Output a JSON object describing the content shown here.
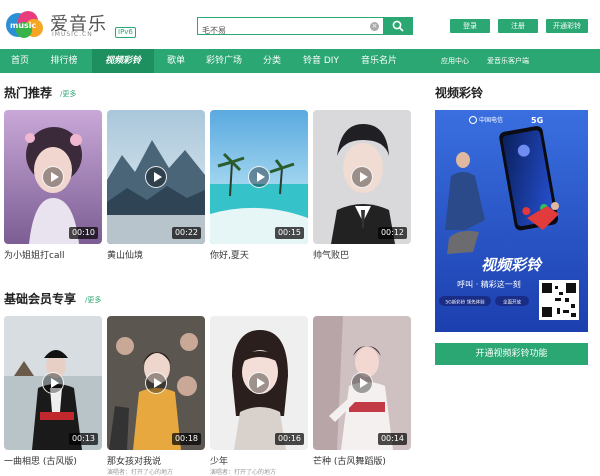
{
  "header": {
    "logo_text": "爱音乐",
    "logo_domain": "IMUSIC.CN",
    "ipv6_badge": "IPv6",
    "search_value": "毛不易",
    "login_label": "登录",
    "register_label": "注册",
    "open_ringtone_label": "开通彩铃"
  },
  "nav": {
    "items": [
      "首页",
      "排行榜",
      "视频彩铃",
      "歌单",
      "彩铃广场",
      "分类",
      "铃音 DIY",
      "音乐名片"
    ],
    "active_index": 2,
    "app_center": "应用中心",
    "client": "爱音乐客户端"
  },
  "hot": {
    "title": "热门推荐",
    "more": "/更多",
    "cards": [
      {
        "title": "为小姐姐打call",
        "duration": "00:10"
      },
      {
        "title": "黄山仙境",
        "duration": "00:22"
      },
      {
        "title": "你好,夏天",
        "duration": "00:15"
      },
      {
        "title": "帅气败巴",
        "duration": "00:12"
      }
    ]
  },
  "member": {
    "title": "基础会员专享",
    "more": "/更多",
    "cards": [
      {
        "title": "一曲相思 (古风版)",
        "duration": "00:13",
        "sub": ""
      },
      {
        "title": "那女孩对我说",
        "duration": "00:18",
        "sub": "演唱者：打开了心的地方"
      },
      {
        "title": "少年",
        "duration": "00:16",
        "sub": "演唱者：打开了心的地方"
      },
      {
        "title": "芒种 (古风舞蹈版)",
        "duration": "00:14",
        "sub": ""
      }
    ]
  },
  "side": {
    "title": "视频彩铃",
    "banner": {
      "carrier": "中国电信",
      "network": "5G",
      "headline": "视频彩铃",
      "slogan": "呼叫 · 精彩这一刻",
      "tag1": "5G新彩铃 领先体验",
      "tag2": "全面开放"
    },
    "open_button": "开通视频彩铃功能"
  }
}
